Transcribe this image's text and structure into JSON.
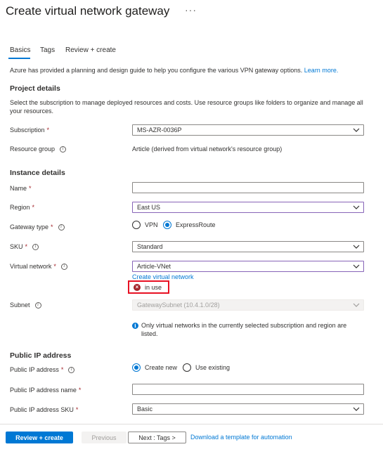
{
  "header": {
    "title": "Create virtual network gateway",
    "more_label": "···"
  },
  "tabs": [
    {
      "label": "Basics",
      "active": true
    },
    {
      "label": "Tags",
      "active": false
    },
    {
      "label": "Review + create",
      "active": false
    }
  ],
  "intro": {
    "text": "Azure has provided a planning and design guide to help you configure the various VPN gateway options.",
    "link": "Learn more."
  },
  "project_details": {
    "heading": "Project details",
    "description": "Select the subscription to manage deployed resources and costs. Use resource groups like folders to organize and manage all your resources.",
    "subscription": {
      "label": "Subscription",
      "value": "MS-AZR-0036P"
    },
    "resource_group": {
      "label": "Resource group",
      "value": "Article (derived from virtual network's resource group)"
    }
  },
  "instance_details": {
    "heading": "Instance details",
    "name": {
      "label": "Name",
      "value": ""
    },
    "region": {
      "label": "Region",
      "value": "East US"
    },
    "gateway_type": {
      "label": "Gateway type",
      "options": [
        {
          "label": "VPN",
          "selected": false
        },
        {
          "label": "ExpressRoute",
          "selected": true
        }
      ]
    },
    "sku": {
      "label": "SKU",
      "value": "Standard"
    },
    "virtual_network": {
      "label": "Virtual network",
      "value": "Article-VNet",
      "create_link": "Create virtual network",
      "error": "in use"
    },
    "subnet": {
      "label": "Subnet",
      "value": "GatewaySubnet (10.4.1.0/28)",
      "info": "Only virtual networks in the currently selected subscription and region are listed."
    }
  },
  "public_ip": {
    "heading": "Public IP address",
    "address": {
      "label": "Public IP address",
      "options": [
        {
          "label": "Create new",
          "selected": true
        },
        {
          "label": "Use existing",
          "selected": false
        }
      ]
    },
    "name": {
      "label": "Public IP address name",
      "value": ""
    },
    "sku": {
      "label": "Public IP address SKU",
      "value": "Basic"
    }
  },
  "footer": {
    "review_create": "Review + create",
    "previous": "Previous",
    "next": "Next : Tags >",
    "template_link": "Download a template for automation"
  },
  "icons": {
    "info": "info-icon",
    "chevron": "chevron-down-icon",
    "error": "error-icon"
  },
  "colors": {
    "accent": "#0078d4",
    "error": "#a4262c",
    "highlight_border": "#e81123",
    "focus_border": "#8764b8"
  }
}
